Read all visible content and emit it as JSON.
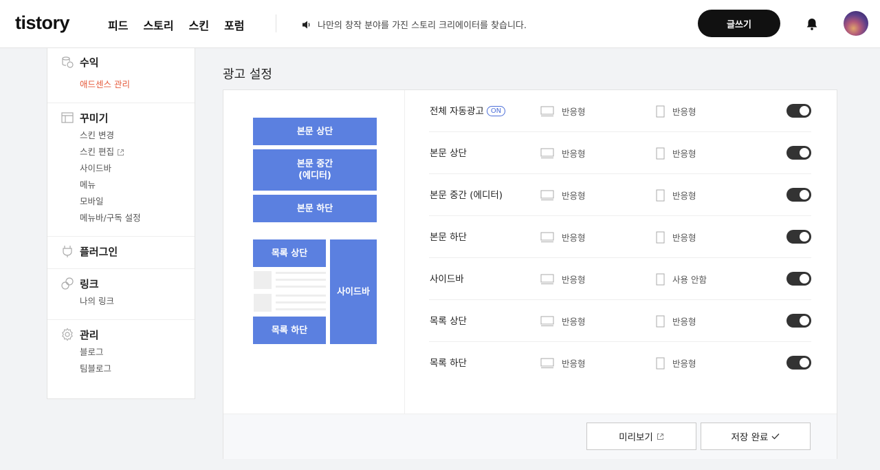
{
  "header": {
    "logo": "tistory",
    "nav": [
      "피드",
      "스토리",
      "스킨",
      "포럼"
    ],
    "notice": "나만의 창작 분야를 가진 스토리 크리에이터를 찾습니다.",
    "write_label": "글쓰기"
  },
  "sidebar": {
    "revenue": {
      "title": "수익",
      "items": [
        "애드센스 관리"
      ]
    },
    "decorate": {
      "title": "꾸미기",
      "items": [
        "스킨 변경",
        "스킨 편집",
        "사이드바",
        "메뉴",
        "모바일",
        "메뉴바/구독 설정"
      ]
    },
    "plugin": {
      "title": "플러그인"
    },
    "link": {
      "title": "링크",
      "items": [
        "나의 링크"
      ]
    },
    "manage": {
      "title": "관리",
      "items": [
        "블로그",
        "팀블로그"
      ]
    }
  },
  "page_title": "광고 설정",
  "preview": {
    "body_top": "본문 상단",
    "body_middle_1": "본문 중간",
    "body_middle_2": "(에디터)",
    "body_bottom": "본문 하단",
    "list_top": "목록 상단",
    "list_bottom": "목록 하단",
    "sidebar": "사이드바"
  },
  "on_badge": "ON",
  "rows": [
    {
      "label": "전체 자동광고",
      "pc": "반응형",
      "mobile": "반응형",
      "enabled": true
    },
    {
      "label": "본문 상단",
      "pc": "반응형",
      "mobile": "반응형",
      "enabled": true
    },
    {
      "label": "본문 중간 (에디터)",
      "pc": "반응형",
      "mobile": "반응형",
      "enabled": true
    },
    {
      "label": "본문 하단",
      "pc": "반응형",
      "mobile": "반응형",
      "enabled": true
    },
    {
      "label": "사이드바",
      "pc": "반응형",
      "mobile": "사용 안함",
      "enabled": true
    },
    {
      "label": "목록 상단",
      "pc": "반응형",
      "mobile": "반응형",
      "enabled": true
    },
    {
      "label": "목록 하단",
      "pc": "반응형",
      "mobile": "반응형",
      "enabled": true
    }
  ],
  "footer": {
    "preview_label": "미리보기",
    "save_label": "저장 완료"
  },
  "colors": {
    "accent": "#5b80e0",
    "active_menu": "#e55b3c",
    "toggle_on": "#333333"
  }
}
